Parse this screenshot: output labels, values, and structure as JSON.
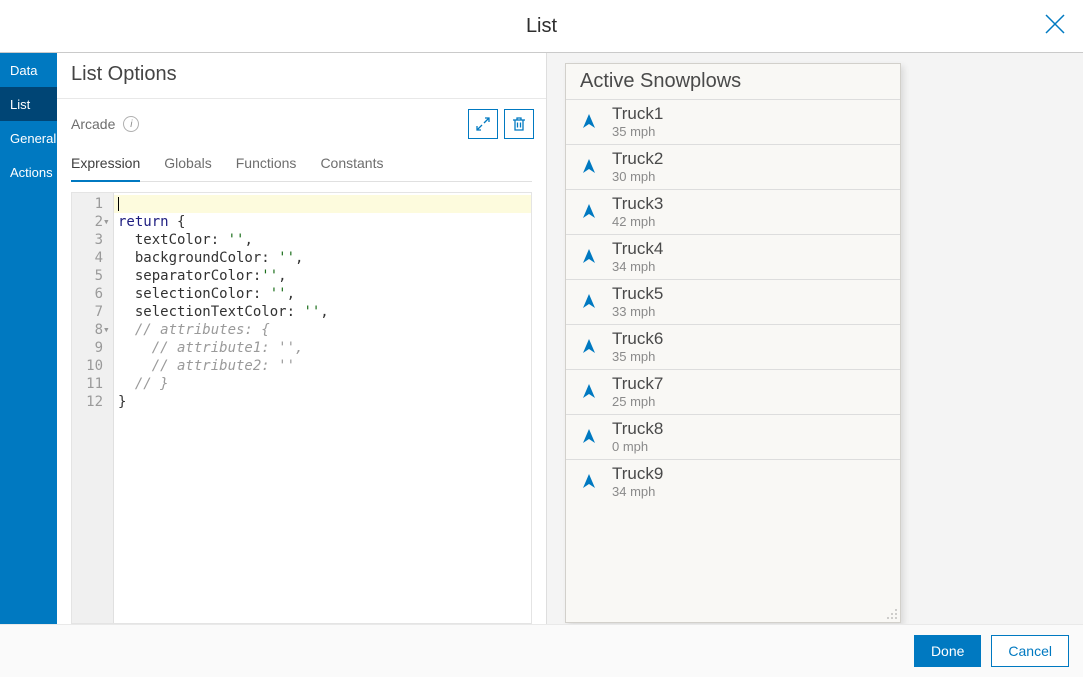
{
  "header": {
    "title": "List"
  },
  "sidebar": {
    "items": [
      {
        "label": "Data",
        "active": false
      },
      {
        "label": "List",
        "active": true
      },
      {
        "label": "General",
        "active": false
      },
      {
        "label": "Actions",
        "active": false
      }
    ]
  },
  "options": {
    "title": "List Options",
    "language_label": "Arcade",
    "editor_tabs": [
      {
        "label": "Expression",
        "active": true
      },
      {
        "label": "Globals",
        "active": false
      },
      {
        "label": "Functions",
        "active": false
      },
      {
        "label": "Constants",
        "active": false
      }
    ],
    "code_lines": [
      {
        "n": 1,
        "text": "",
        "hl": true,
        "fold": false
      },
      {
        "n": 2,
        "text": "return {",
        "hl": false,
        "fold": true
      },
      {
        "n": 3,
        "text": "  textColor: '',",
        "hl": false,
        "fold": false
      },
      {
        "n": 4,
        "text": "  backgroundColor: '',",
        "hl": false,
        "fold": false
      },
      {
        "n": 5,
        "text": "  separatorColor:'',",
        "hl": false,
        "fold": false
      },
      {
        "n": 6,
        "text": "  selectionColor: '',",
        "hl": false,
        "fold": false
      },
      {
        "n": 7,
        "text": "  selectionTextColor: '',",
        "hl": false,
        "fold": false
      },
      {
        "n": 8,
        "text": "  // attributes: {",
        "hl": false,
        "fold": true
      },
      {
        "n": 9,
        "text": "    // attribute1: '',",
        "hl": false,
        "fold": false
      },
      {
        "n": 10,
        "text": "    // attribute2: ''",
        "hl": false,
        "fold": false
      },
      {
        "n": 11,
        "text": "  // }",
        "hl": false,
        "fold": false
      },
      {
        "n": 12,
        "text": "}",
        "hl": false,
        "fold": false
      }
    ]
  },
  "preview": {
    "title": "Active Snowplows",
    "items": [
      {
        "name": "Truck1",
        "sub": "35 mph"
      },
      {
        "name": "Truck2",
        "sub": "30 mph"
      },
      {
        "name": "Truck3",
        "sub": "42 mph"
      },
      {
        "name": "Truck4",
        "sub": "34 mph"
      },
      {
        "name": "Truck5",
        "sub": "33 mph"
      },
      {
        "name": "Truck6",
        "sub": "35 mph"
      },
      {
        "name": "Truck7",
        "sub": "25 mph"
      },
      {
        "name": "Truck8",
        "sub": "0 mph"
      },
      {
        "name": "Truck9",
        "sub": "34 mph"
      }
    ]
  },
  "footer": {
    "done_label": "Done",
    "cancel_label": "Cancel"
  }
}
